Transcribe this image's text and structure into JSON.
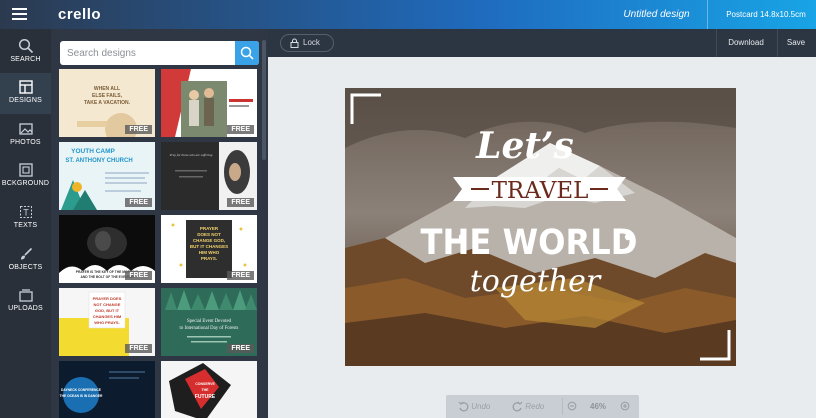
{
  "app": {
    "logo": "crello",
    "doc_title": "Untitled design",
    "format_label": "Postcard 14.8x10.5cm"
  },
  "rail": [
    {
      "label": "SEARCH",
      "icon": "search-icon"
    },
    {
      "label": "DESIGNS",
      "icon": "layout-icon",
      "active": true
    },
    {
      "label": "PHOTOS",
      "icon": "image-icon"
    },
    {
      "label": "BCKGROUND",
      "icon": "background-icon"
    },
    {
      "label": "TEXTS",
      "icon": "text-icon"
    },
    {
      "label": "OBJECTS",
      "icon": "brush-icon"
    },
    {
      "label": "UPLOADS",
      "icon": "upload-icon"
    }
  ],
  "search": {
    "placeholder": "Search designs"
  },
  "templates": {
    "free_badge": "FREE",
    "t1": {
      "lines": [
        "WHEN ALL",
        "ELSE FAILS,",
        "TAKE A VACATION."
      ]
    },
    "t3": {
      "lines": [
        "YOUTH CAMP",
        "ST. ANTHONY CHURCH"
      ]
    },
    "t4": {
      "lines": [
        "Pray for those who are suffering"
      ]
    },
    "t5": {
      "lines": [
        "PRAYER IS THE KEY OF THE MORNING",
        "AND THE BOLT OF THE EVENING"
      ]
    },
    "t6": {
      "lines": [
        "PRAYER",
        "DOES NOT",
        "CHANGE GOD,",
        "BUT IT CHANGES",
        "HIM WHO",
        "PRAYS."
      ]
    },
    "t7": {
      "lines": [
        "PRAYER DOES",
        "NOT CHANGE",
        "GOD, BUT IT",
        "CHANGES HIM",
        "WHO PRAYS."
      ]
    },
    "t8": {
      "lines": [
        "Special Event Devoted",
        "to International Day of Forests"
      ]
    },
    "t9": {
      "lines": [
        "DAYNECK CONFERENCE",
        "THE OCEAN IS IN DANGER"
      ]
    },
    "t10": {
      "lines": [
        "CONSERVE",
        "THE",
        "FUTURE"
      ]
    }
  },
  "toolbar": {
    "lock_label": "Lock",
    "download_label": "Download",
    "save_label": "Save"
  },
  "design": {
    "line1": "Let’s",
    "line2": "TRAVEL",
    "line3": "THE WORLD",
    "line4": "together"
  },
  "bottom": {
    "undo": "Undo",
    "redo": "Redo",
    "zoom": "46%"
  },
  "colors": {
    "accent": "#3aa3e8",
    "rail_bg": "#293039",
    "panel_bg": "#2f3744",
    "banner_text": "#6b2a1c"
  }
}
